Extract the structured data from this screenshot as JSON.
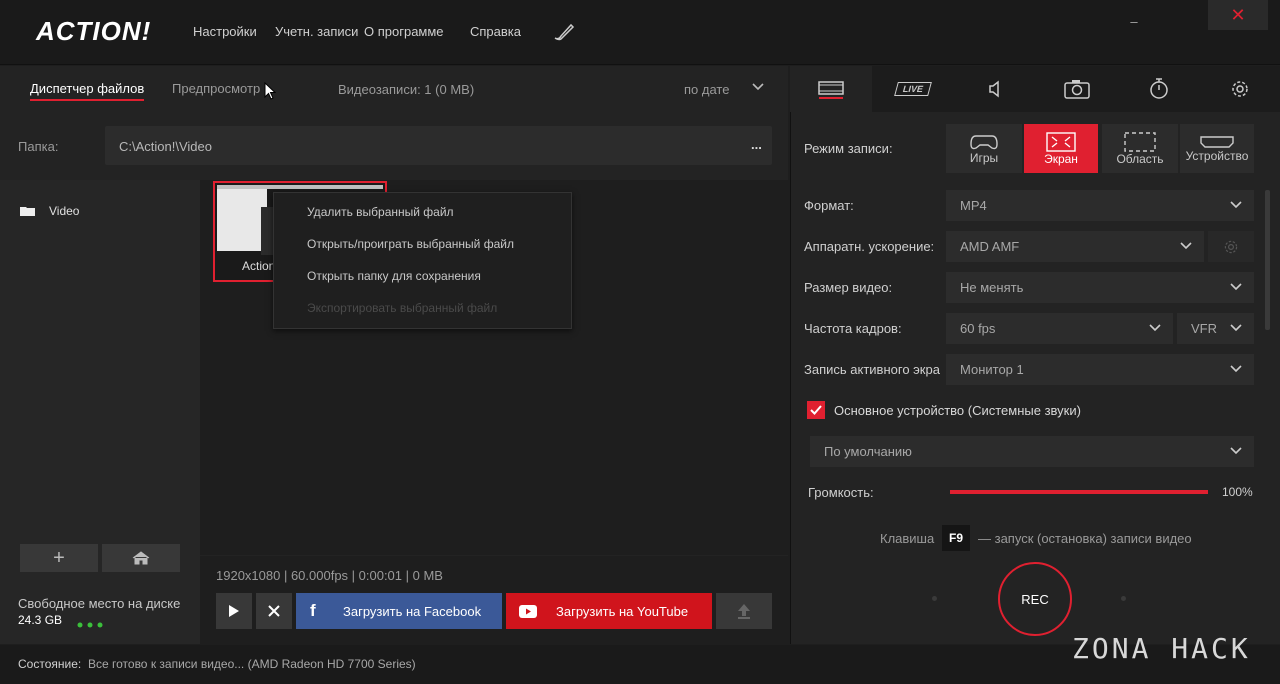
{
  "app": {
    "logo": "ACTION!",
    "menu": [
      "Настройки",
      "Учетн. записи",
      "О программе",
      "Справка"
    ],
    "window_controls": {
      "minimize": "–",
      "close": "✕"
    }
  },
  "file_manager": {
    "tabs": [
      "Диспетчер файлов",
      "Предпросмотр"
    ],
    "recordings_info": "Видеозаписи: 1 (0 MB)",
    "sort_label": "по дате",
    "folder_label": "Папка:",
    "folder_path": "C:\\Action!\\Video",
    "folder_more": "...",
    "tree_items": [
      "Video"
    ],
    "thumb_label": "Action",
    "context_menu": [
      {
        "label": "Удалить выбранный файл",
        "enabled": true
      },
      {
        "label": "Открыть/проиграть выбранный файл",
        "enabled": true
      },
      {
        "label": "Открыть папку для сохранения",
        "enabled": true
      },
      {
        "label": "Экспортировать выбранный файл",
        "enabled": false
      }
    ],
    "file_info": "1920x1080 | 60.000fps | 0:00:01 | 0 MB",
    "buttons": {
      "add": "+",
      "facebook": "Загрузить на Facebook",
      "youtube": "Загрузить на YouTube"
    },
    "disk": {
      "label": "Свободное место на диске",
      "value": "24.3 GB"
    }
  },
  "status": {
    "label": "Состояние:",
    "text": "Все готово к записи видео... (AMD Radeon HD 7700 Series)"
  },
  "settings": {
    "tabs": [
      "video-tab",
      "live-tab",
      "audio-tab",
      "screenshot-tab",
      "timer-tab",
      "settings-tab"
    ],
    "live_label": "LIVE",
    "mode_label": "Режим записи:",
    "modes": [
      {
        "label": "Игры",
        "active": false
      },
      {
        "label": "Экран",
        "active": true
      },
      {
        "label": "Область",
        "active": false
      },
      {
        "label": "Устройство",
        "active": false
      }
    ],
    "format_label": "Формат:",
    "format_value": "MP4",
    "hw_label": "Аппаратн. ускорение:",
    "hw_value": "AMD AMF",
    "size_label": "Размер видео:",
    "size_value": "Не менять",
    "fps_label": "Частота кадров:",
    "fps_value": "60 fps",
    "fps_mode": "VFR",
    "active_screen_label": "Запись активного экра",
    "active_screen_value": "Монитор 1",
    "audio_device_label": "Основное устройство (Системные звуки)",
    "audio_device_checked": true,
    "audio_device_value": "По умолчанию",
    "volume_label": "Громкость:",
    "volume_value": "100%",
    "volume_level": 1.0,
    "hotkey_prefix": "Клавиша",
    "hotkey": "F9",
    "hotkey_suffix": "— запуск (остановка) записи видео",
    "rec_label": "REC"
  },
  "watermark": "ZONA HACK",
  "colors": {
    "accent": "#e02030",
    "facebook": "#3b5998",
    "youtube": "#d0141c"
  }
}
